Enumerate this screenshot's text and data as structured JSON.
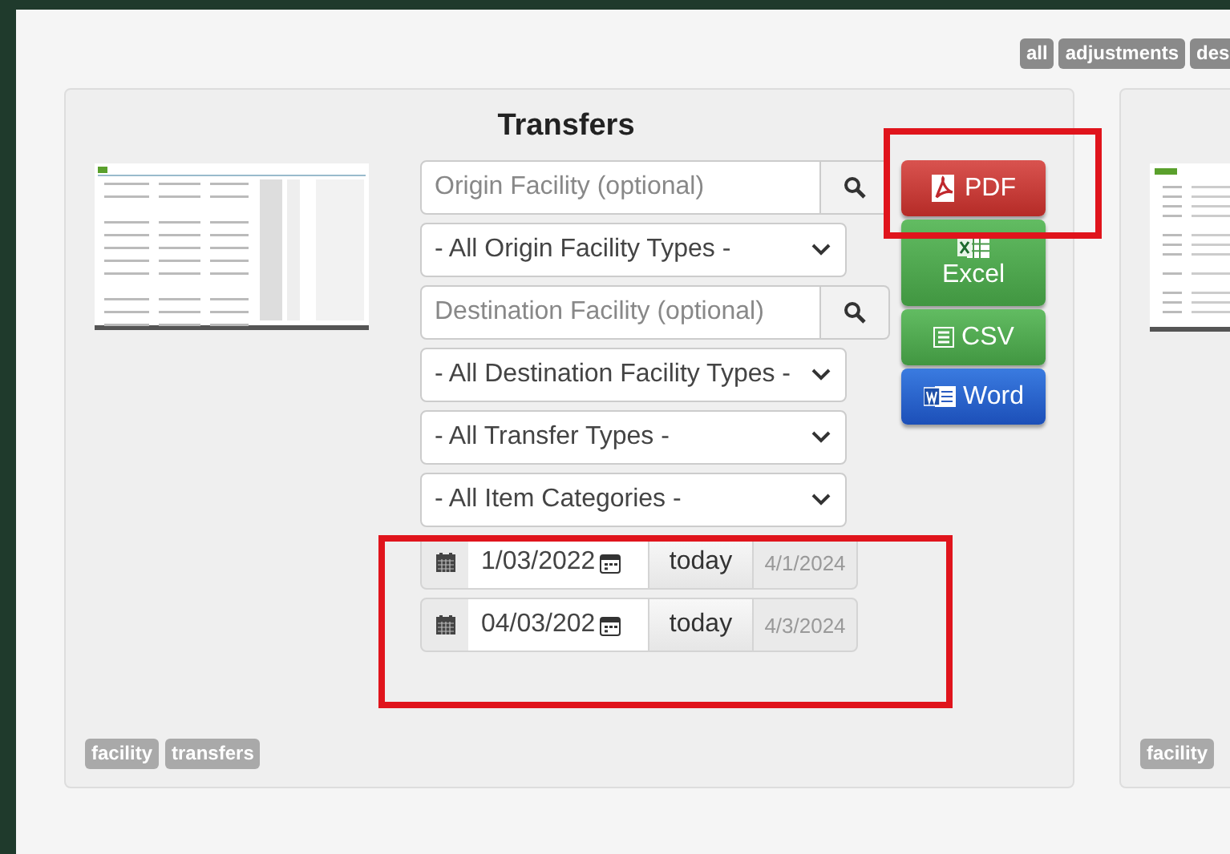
{
  "top_tags": [
    "all",
    "adjustments",
    "des"
  ],
  "report": {
    "title": "Transfers",
    "fields": [
      {
        "kind": "search",
        "placeholder": "Origin Facility (optional)"
      },
      {
        "kind": "select",
        "value": "- All Origin Facility Types -"
      },
      {
        "kind": "search",
        "placeholder": "Destination Facility (optional)"
      },
      {
        "kind": "select",
        "value": "- All Destination Facility Types -"
      },
      {
        "kind": "select",
        "value": "- All Transfer Types -"
      },
      {
        "kind": "select",
        "value": "- All Item Categories -"
      }
    ],
    "dates": [
      {
        "value": "1/03/2022",
        "button": "today",
        "hint": "4/1/2024"
      },
      {
        "value": "04/03/202",
        "button": "today",
        "hint": "4/3/2024"
      }
    ],
    "exports": [
      {
        "kind": "pdf",
        "label": "PDF"
      },
      {
        "kind": "excel",
        "label": "Excel"
      },
      {
        "kind": "csv",
        "label": "CSV"
      },
      {
        "kind": "word",
        "label": "Word"
      }
    ],
    "tags": [
      "facility",
      "transfers"
    ]
  },
  "next_report": {
    "tags": [
      "facility"
    ]
  }
}
